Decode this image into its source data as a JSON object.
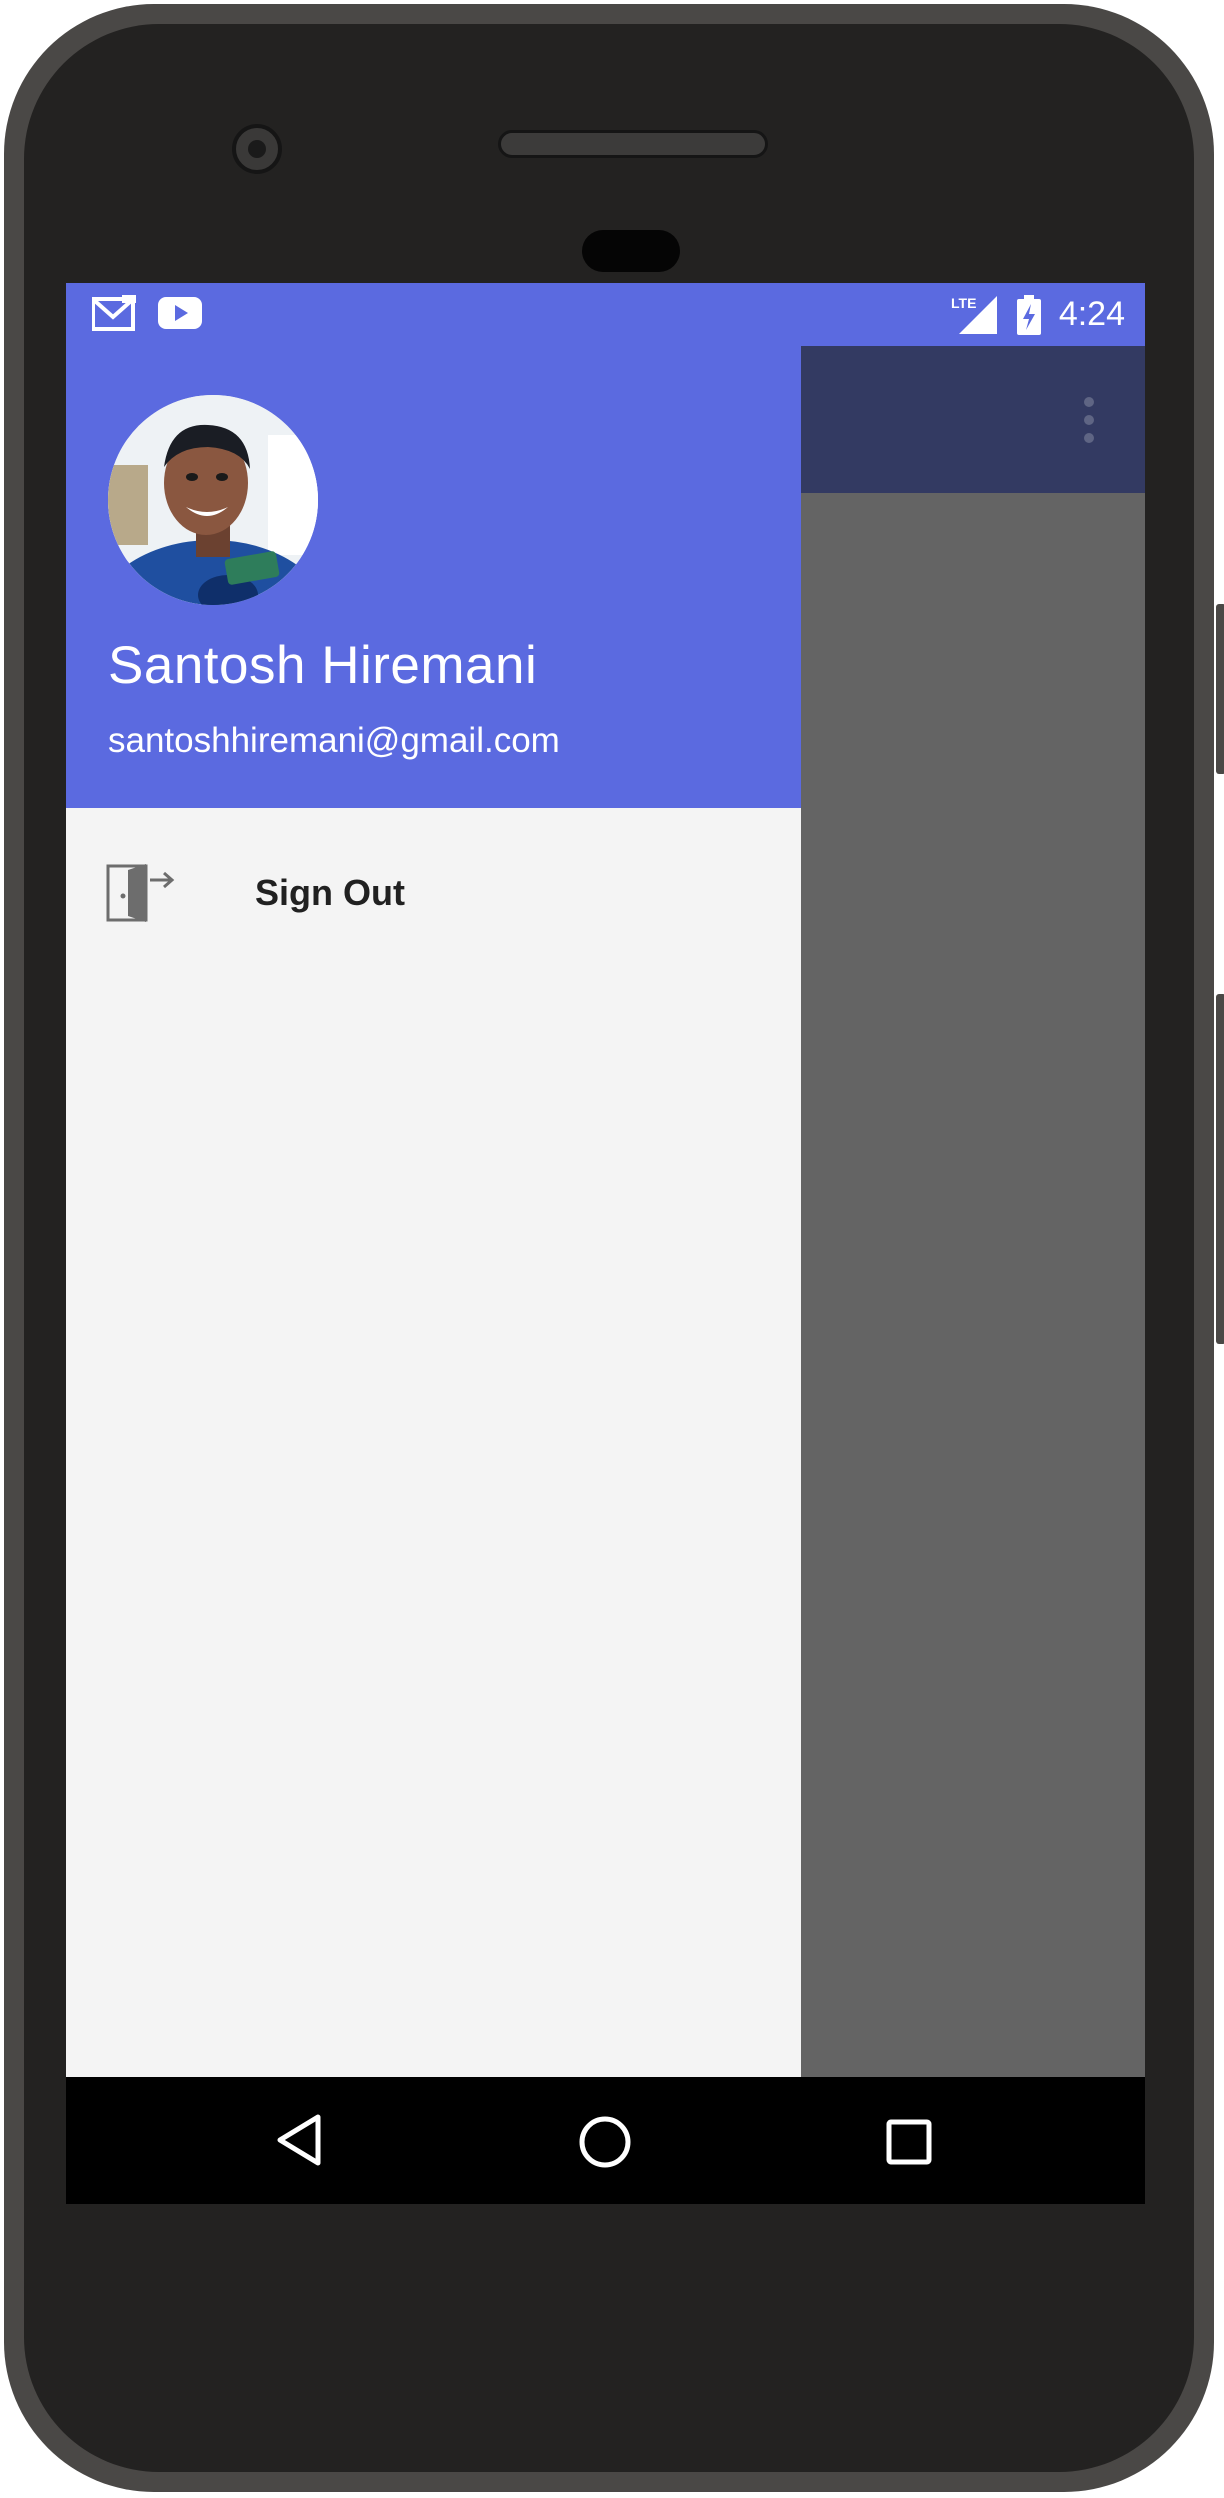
{
  "status_bar": {
    "time": "4:24",
    "network_label": "LTE",
    "icons_left": [
      "gmail-icon",
      "youtube-icon"
    ],
    "icons_right": [
      "signal-icon",
      "battery-charging-icon"
    ]
  },
  "drawer": {
    "user_name": "Santosh Hiremani",
    "user_email": "santoshhiremani@gmail.com",
    "items": [
      {
        "label": "Sign Out",
        "icon": "sign-out-icon"
      }
    ]
  },
  "toolbar": {
    "overflow_icon": "more-vert-icon"
  },
  "nav_bar": {
    "buttons": [
      "back-icon",
      "home-icon",
      "recents-icon"
    ]
  },
  "colors": {
    "primary": "#5b6ae0",
    "toolbar_dimmed": "#333a62",
    "scrim": "#646464",
    "drawer_bg": "#f4f4f4",
    "text_primary": "#212121"
  }
}
